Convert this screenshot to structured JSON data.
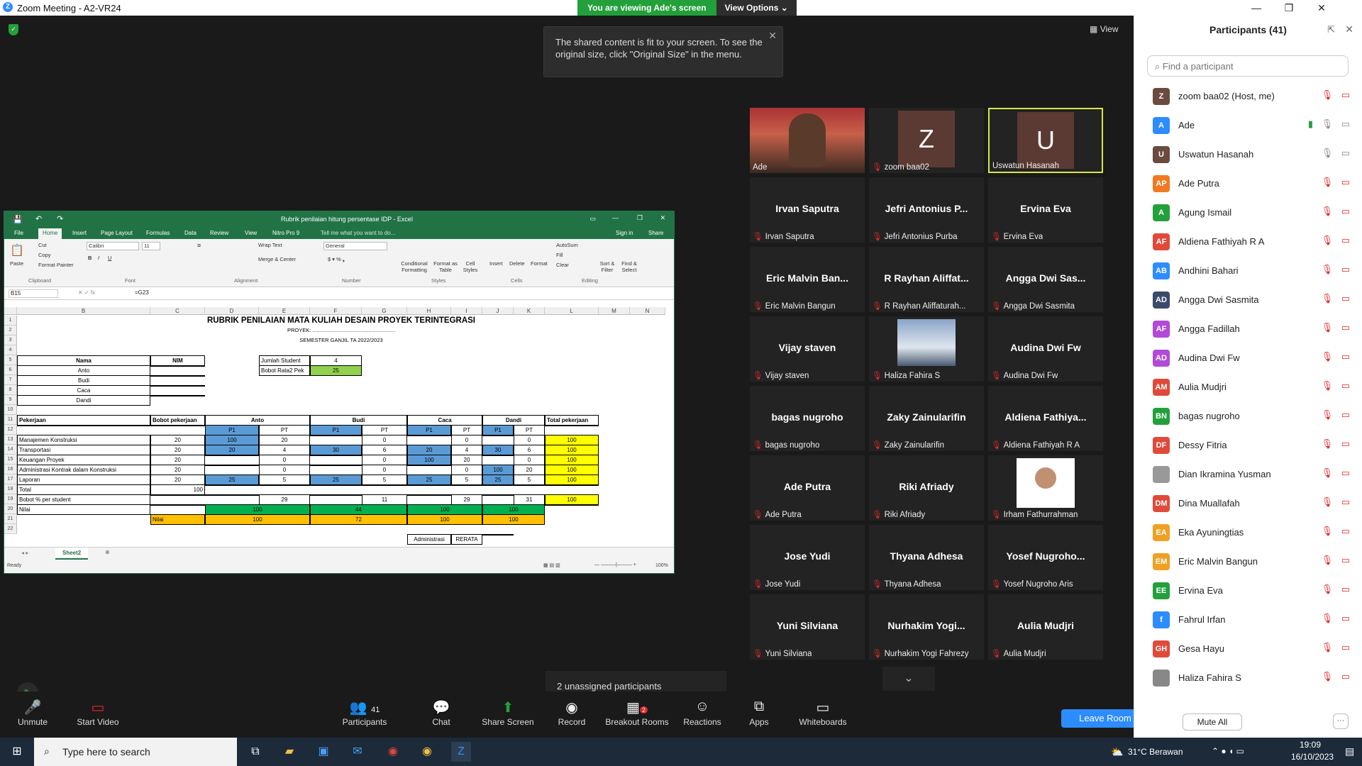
{
  "window": {
    "title": "Zoom Meeting - A2-VR24",
    "minimize": "—",
    "restore": "❐",
    "close": "✕"
  },
  "banner": {
    "viewing": "You are viewing Ade's screen",
    "options": "View Options"
  },
  "view_label": "View",
  "tooltip": {
    "text": "The shared content is fit to your screen. To see the original size, click \"Original Size\" in the menu."
  },
  "excel": {
    "title": "Rubrik penilaian hitung persentase IDP - Excel",
    "tabs": [
      "File",
      "Home",
      "Insert",
      "Page Layout",
      "Formulas",
      "Data",
      "Review",
      "View",
      "Nitro Pro 9",
      "Tell me what you want to do..."
    ],
    "sign_in": "Sign in",
    "share": "Share",
    "ribbon": {
      "cut": "Cut",
      "copy": "Copy",
      "format_painter": "Format Painter",
      "paste": "Paste",
      "clipboard": "Clipboard",
      "font_name": "Calibri",
      "font_size": "11",
      "font": "Font",
      "wrap_text": "Wrap Text",
      "merge_center": "Merge & Center",
      "alignment": "Alignment",
      "number_format": "General",
      "number": "Number",
      "conditional": "Conditional Formatting",
      "format_as_table": "Format as Table",
      "cell_styles": "Cell Styles",
      "styles": "Styles",
      "insert": "Insert",
      "delete": "Delete",
      "format": "Format",
      "cells": "Cells",
      "autosum": "AutoSum",
      "fill": "Fill",
      "clear": "Clear",
      "sort_filter": "Sort & Filter",
      "find_select": "Find & Select",
      "editing": "Editing"
    },
    "name_box": "B15",
    "formula": "=G23",
    "columns": [
      "B",
      "C",
      "D",
      "E",
      "F",
      "G",
      "H",
      "I",
      "J",
      "K",
      "L",
      "M",
      "N"
    ],
    "rows": [
      "1",
      "2",
      "3",
      "4",
      "5",
      "6",
      "7",
      "8",
      "9",
      "10",
      "11",
      "12",
      "13",
      "14",
      "15",
      "16",
      "17",
      "18",
      "19",
      "20",
      "21",
      "22"
    ],
    "sheet": {
      "title": "RUBRIK PENILAIAN MATA KULIAH DESAIN PROYEK TERINTEGRASI",
      "proyek": "PROYEK: ........................................................",
      "semester": "SEMESTER GANJIL TA 2022/2023",
      "nama": "Nama",
      "nim": "NIM",
      "students": [
        "Anto",
        "Budi",
        "Caca",
        "Dandi"
      ],
      "jumlah_student_label": "Jumlah Student",
      "jumlah_student": "4",
      "bobot_label": "Bobot Rata2 Pek",
      "bobot": "25",
      "pekerjaan": "Pekerjaan",
      "bobot_pekerjaan": "Bobot pekerjaan",
      "total_pekerjaan": "Total pekerjaan",
      "p1": "P1",
      "pt": "PT",
      "tasks": [
        {
          "name": "Manajemen Konstruksi",
          "bobot": "20",
          "anto": [
            "100",
            "20"
          ],
          "budi": [
            "",
            "0"
          ],
          "caca": [
            "",
            "0"
          ],
          "dandi": [
            "",
            "0"
          ],
          "total": "100"
        },
        {
          "name": "Transportasi",
          "bobot": "20",
          "anto": [
            "20",
            "4"
          ],
          "budi": [
            "30",
            "6"
          ],
          "caca": [
            "20",
            "4"
          ],
          "dandi": [
            "30",
            "6"
          ],
          "total": "100"
        },
        {
          "name": "Keuangan Proyek",
          "bobot": "20",
          "anto": [
            "",
            "0"
          ],
          "budi": [
            "",
            "0"
          ],
          "caca": [
            "100",
            "20"
          ],
          "dandi": [
            "",
            "0"
          ],
          "total": "100"
        },
        {
          "name": "Administrasi Kontrak dalam Konstruksi",
          "bobot": "20",
          "anto": [
            "",
            "0"
          ],
          "budi": [
            "",
            "0"
          ],
          "caca": [
            "",
            "0"
          ],
          "dandi": [
            "100",
            "20"
          ],
          "total": "100"
        },
        {
          "name": "Laporan",
          "bobot": "20",
          "anto": [
            "25",
            "5"
          ],
          "budi": [
            "25",
            "5"
          ],
          "caca": [
            "25",
            "5"
          ],
          "dandi": [
            "25",
            "5"
          ],
          "total": "100"
        }
      ],
      "total_label": "Total",
      "total_value": "100",
      "bobot_per_student": "Bobot % per student",
      "bps": {
        "anto": "29",
        "budi": "11",
        "caca": "29",
        "dandi": "31",
        "total": "100"
      },
      "nilai": "Nilai",
      "nilai_row": {
        "anto": "100",
        "budi": "44",
        "caca": "100",
        "dandi": "100"
      },
      "nilai2_row": {
        "anto": "100",
        "budi": "72",
        "caca": "100",
        "dandi": "100"
      },
      "administrasi": "Administrasi",
      "rerata": "RERATA"
    },
    "sheet_tab": "Sheet2",
    "status": "Ready",
    "zoom": "100%"
  },
  "tiles": [
    {
      "name": "",
      "label": "Ade",
      "muted": false,
      "type": "photo"
    },
    {
      "name": "Z",
      "label": "zoom baa02",
      "muted": true,
      "type": "avatar",
      "color": "#5b3a33"
    },
    {
      "name": "U",
      "label": "Uswatun Hasanah",
      "muted": false,
      "type": "avatar",
      "color": "#5b3a33",
      "active": true
    },
    {
      "name": "Irvan Saputra",
      "label": "Irvan Saputra",
      "muted": true
    },
    {
      "name": "Jefri Antonius P...",
      "label": "Jefri Antonius Purba",
      "muted": true
    },
    {
      "name": "Ervina Eva",
      "label": "Ervina Eva",
      "muted": true
    },
    {
      "name": "Eric Malvin Ban...",
      "label": "Eric Malvin Bangun",
      "muted": true
    },
    {
      "name": "R Rayhan Aliffat...",
      "label": "R Rayhan Aliffaturah...",
      "muted": true
    },
    {
      "name": "Angga Dwi Sas...",
      "label": "Angga Dwi Sasmita",
      "muted": true
    },
    {
      "name": "Vijay staven",
      "label": "Vijay staven",
      "muted": true
    },
    {
      "name": "",
      "label": "Haliza Fahira S",
      "muted": true,
      "type": "photo2"
    },
    {
      "name": "Audina Dwi Fw",
      "label": "Audina Dwi Fw",
      "muted": true
    },
    {
      "name": "bagas nugroho",
      "label": "bagas nugroho",
      "muted": true
    },
    {
      "name": "Zaky Zainularifin",
      "label": "Zaky Zainularifin",
      "muted": true
    },
    {
      "name": "Aldiena  Fathiya...",
      "label": "Aldiena Fathiyah R A",
      "muted": true
    },
    {
      "name": "Ade Putra",
      "label": "Ade Putra",
      "muted": true
    },
    {
      "name": "Riki Afriady",
      "label": "Riki Afriady",
      "muted": true
    },
    {
      "name": "",
      "label": "Irham Fathurrahman",
      "muted": true,
      "type": "photo3"
    },
    {
      "name": "Jose Yudi",
      "label": "Jose Yudi",
      "muted": true
    },
    {
      "name": "Thyana Adhesa",
      "label": "Thyana Adhesa",
      "muted": true
    },
    {
      "name": "Yosef  Nugroho...",
      "label": "Yosef Nugroho Aris",
      "muted": true
    },
    {
      "name": "Yuni Silviana",
      "label": "Yuni Silviana",
      "muted": true
    },
    {
      "name": "Nurhakim  Yogi...",
      "label": "Nurhakim Yogi Fahrezy",
      "muted": true
    },
    {
      "name": "Aulia Mudjri",
      "label": "Aulia Mudjri",
      "muted": true
    }
  ],
  "unassigned": "2 unassigned participants",
  "toolbar": {
    "unmute": "Unmute",
    "start_video": "Start Video",
    "participants": "Participants",
    "participants_count": "41",
    "chat": "Chat",
    "share_screen": "Share Screen",
    "record": "Record",
    "breakout": "Breakout Rooms",
    "breakout_badge": "2",
    "reactions": "Reactions",
    "apps": "Apps",
    "whiteboards": "Whiteboards",
    "leave": "Leave Room"
  },
  "panel": {
    "title": "Participants (41)",
    "search_placeholder": "Find a participant",
    "mute_all": "Mute All",
    "more": "···",
    "participants": [
      {
        "initials": "Z",
        "name": "zoom baa02 (Host, me)",
        "color": "#6b4a40"
      },
      {
        "initials": "A",
        "name": "Ade",
        "color": "#2d8cff",
        "unmuted": true
      },
      {
        "initials": "U",
        "name": "Uswatun Hasanah",
        "color": "#6b4a40",
        "mic_gray": true
      },
      {
        "initials": "AP",
        "name": "Ade Putra",
        "color": "#f07a22"
      },
      {
        "initials": "A",
        "name": "Agung Ismail",
        "color": "#23a03b"
      },
      {
        "initials": "AF",
        "name": "Aldiena Fathiyah R A",
        "color": "#e04a3a"
      },
      {
        "initials": "AB",
        "name": "Andhini Bahari",
        "color": "#2d8cff"
      },
      {
        "initials": "AD",
        "name": "Angga Dwi Sasmita",
        "color": "#3a4a6a"
      },
      {
        "initials": "AF",
        "name": "Angga Fadillah",
        "color": "#b24ad8"
      },
      {
        "initials": "AD",
        "name": "Audina Dwi Fw",
        "color": "#b24ad8"
      },
      {
        "initials": "AM",
        "name": "Aulia Mudjri",
        "color": "#e04a3a"
      },
      {
        "initials": "BN",
        "name": "bagas nugroho",
        "color": "#23a03b"
      },
      {
        "initials": "DF",
        "name": "Dessy Fitria",
        "color": "#e04a3a"
      },
      {
        "initials": "",
        "name": "Dian Ikramina Yusman",
        "color": "#999"
      },
      {
        "initials": "DM",
        "name": "Dina Muallafah",
        "color": "#e04a3a"
      },
      {
        "initials": "EA",
        "name": "Eka Ayuningtias",
        "color": "#f0a022"
      },
      {
        "initials": "EM",
        "name": "Eric Malvin Bangun",
        "color": "#f0a022"
      },
      {
        "initials": "EE",
        "name": "Ervina Eva",
        "color": "#23a03b"
      },
      {
        "initials": "f",
        "name": "Fahrul Irfan",
        "color": "#2d8cff"
      },
      {
        "initials": "GH",
        "name": "Gesa Hayu",
        "color": "#e04a3a"
      },
      {
        "initials": "",
        "name": "Haliza Fahira S",
        "color": "#888"
      }
    ]
  },
  "taskbar": {
    "search": "Type here to search",
    "weather": "31°C  Berawan",
    "time": "19:09",
    "date": "16/10/2023"
  }
}
